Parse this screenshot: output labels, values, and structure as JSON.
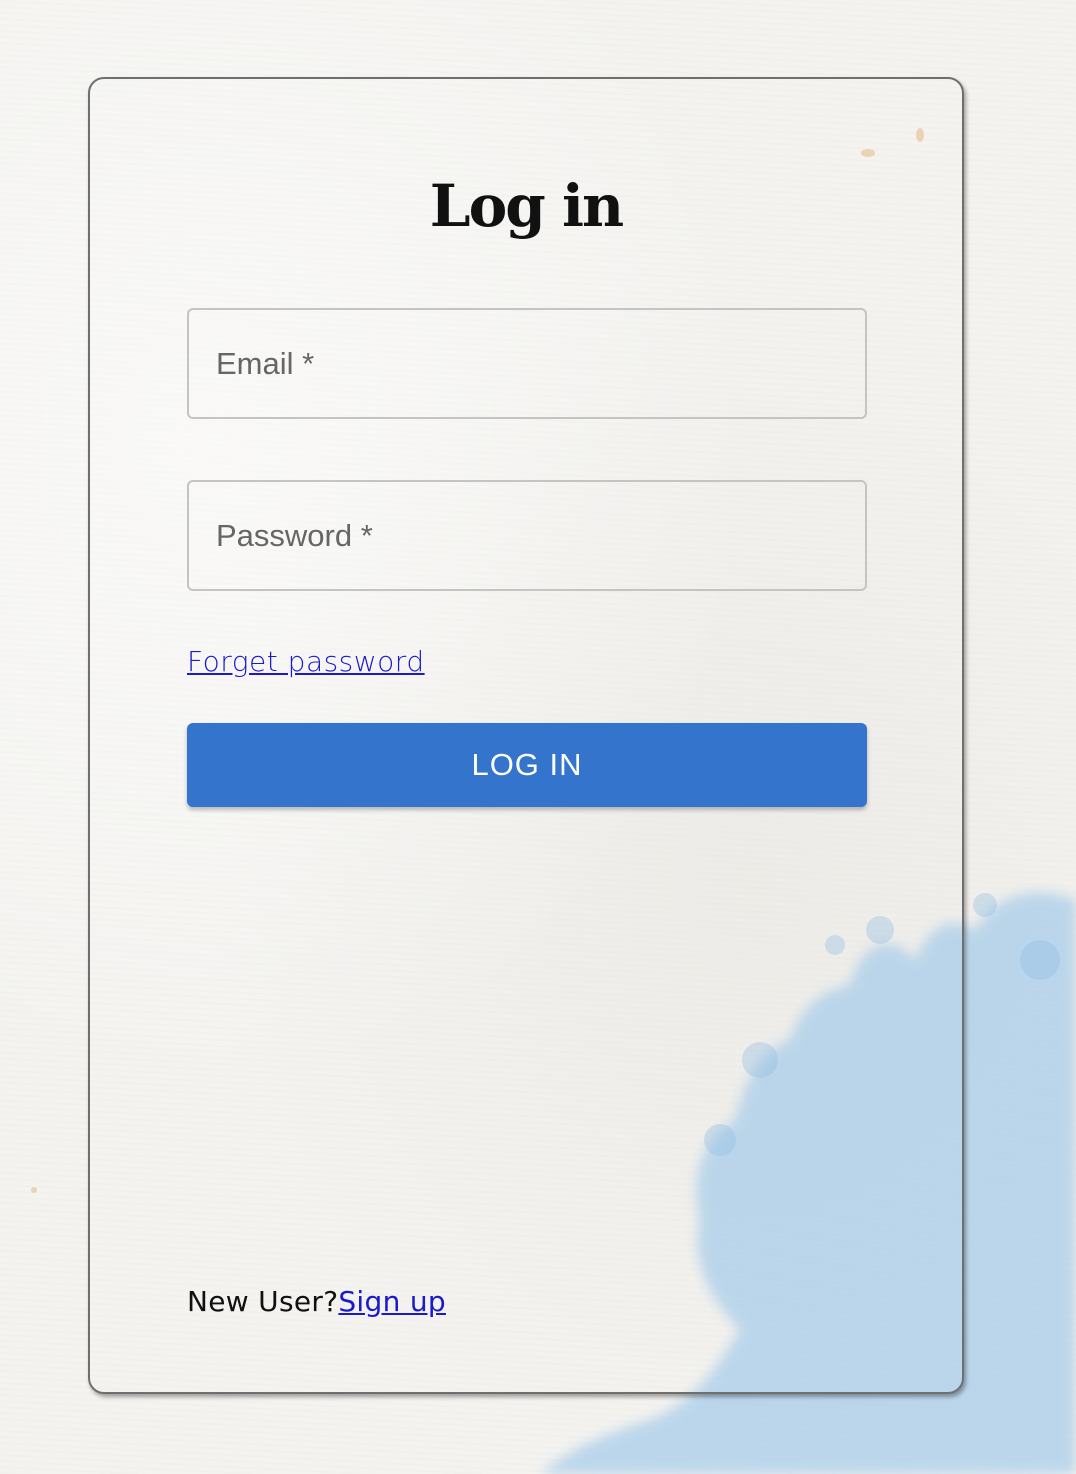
{
  "page": {
    "title": "Log in"
  },
  "form": {
    "email": {
      "label": "Email *",
      "value": ""
    },
    "password": {
      "label": "Password *",
      "value": ""
    },
    "forget_password_link": "Forget password",
    "submit_label": "LOG IN"
  },
  "footer": {
    "new_user_text": "New User?",
    "signup_link": "Sign up"
  },
  "colors": {
    "primary_button": "#3574cc",
    "link": "#1a1acc",
    "splash": "#a9cdea"
  }
}
